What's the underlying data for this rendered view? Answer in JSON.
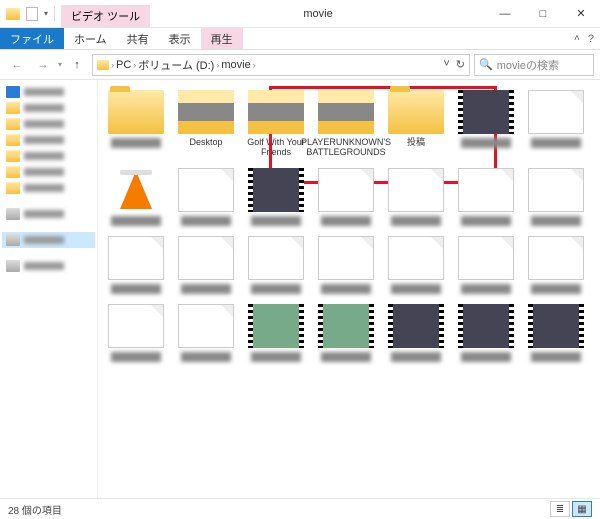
{
  "titlebar": {
    "contextual_label": "ビデオ ツール",
    "title": "movie",
    "min": "—",
    "max": "□",
    "close": "✕"
  },
  "ribbon": {
    "file": "ファイル",
    "home": "ホーム",
    "share": "共有",
    "view": "表示",
    "playback": "再生",
    "help": "?"
  },
  "nav": {
    "back": "←",
    "forward": "→",
    "up": "↑",
    "crumbs": [
      "PC",
      "ボリューム (D:)",
      "movie"
    ],
    "refresh": "↻",
    "dropdown": "˅"
  },
  "search": {
    "placeholder": "movieの検索"
  },
  "tree": {
    "selected": ""
  },
  "items": [
    {
      "name": "",
      "kind": "folder",
      "blur": true
    },
    {
      "name": "Desktop",
      "kind": "folder-preview"
    },
    {
      "name": "Golf With Your Friends",
      "kind": "folder-preview"
    },
    {
      "name": "PLAYERUNKNOWN'S BATTLEGROUNDS",
      "kind": "folder-preview"
    },
    {
      "name": "投稿",
      "kind": "folder"
    },
    {
      "name": "",
      "kind": "video dark",
      "blur": true
    },
    {
      "name": "",
      "kind": "doc",
      "blur": true
    },
    {
      "name": "",
      "kind": "vlc",
      "blur": true
    },
    {
      "name": "",
      "kind": "doc",
      "blur": true
    },
    {
      "name": "",
      "kind": "video dark",
      "blur": true
    },
    {
      "name": "",
      "kind": "doc",
      "blur": true
    },
    {
      "name": "",
      "kind": "doc",
      "blur": true
    },
    {
      "name": "",
      "kind": "doc",
      "blur": true
    },
    {
      "name": "",
      "kind": "doc",
      "blur": true
    },
    {
      "name": "",
      "kind": "doc",
      "blur": true
    },
    {
      "name": "",
      "kind": "doc",
      "blur": true
    },
    {
      "name": "",
      "kind": "doc",
      "blur": true
    },
    {
      "name": "",
      "kind": "doc",
      "blur": true
    },
    {
      "name": "",
      "kind": "doc",
      "blur": true
    },
    {
      "name": "",
      "kind": "doc",
      "blur": true
    },
    {
      "name": "",
      "kind": "doc",
      "blur": true
    },
    {
      "name": "",
      "kind": "doc",
      "blur": true
    },
    {
      "name": "",
      "kind": "doc",
      "blur": true
    },
    {
      "name": "",
      "kind": "video",
      "blur": true
    },
    {
      "name": "",
      "kind": "video",
      "blur": true
    },
    {
      "name": "",
      "kind": "video dark",
      "blur": true
    },
    {
      "name": "",
      "kind": "video dark",
      "blur": true
    },
    {
      "name": "",
      "kind": "video dark",
      "blur": true
    }
  ],
  "status": {
    "count": "28 個の項目"
  }
}
